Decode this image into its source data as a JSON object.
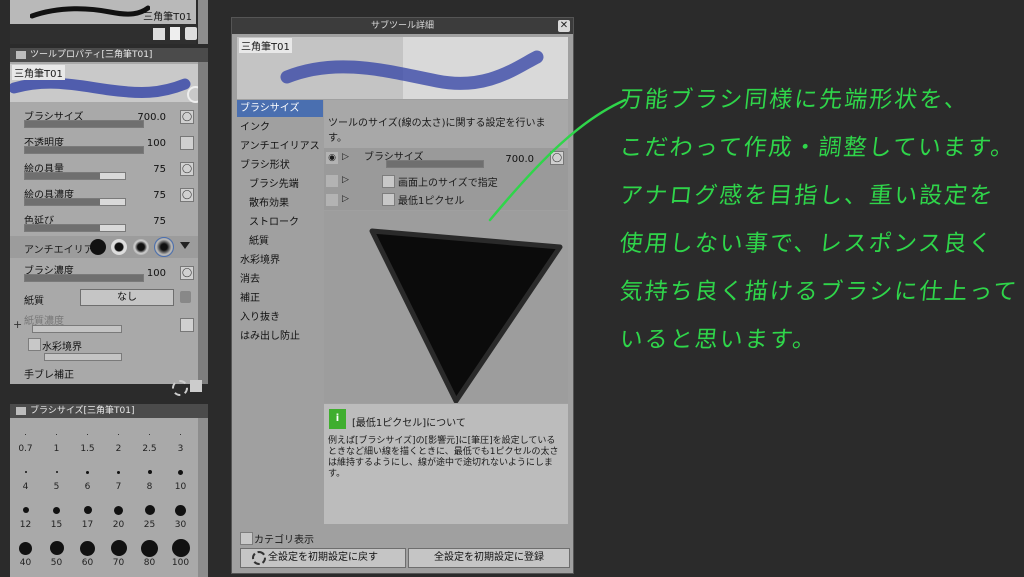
{
  "left_panel": {
    "brush_name_top": "三角筆T01",
    "tool_property_title": "ツールプロパティ[三角筆T01]",
    "brush_name_preview": "三角筆T01",
    "props": [
      {
        "label": "ブラシサイズ",
        "value": "700.0"
      },
      {
        "label": "不透明度",
        "value": "100"
      },
      {
        "label": "絵の具量",
        "value": "75"
      },
      {
        "label": "絵の具濃度",
        "value": "75"
      },
      {
        "label": "色延び",
        "value": "75"
      }
    ],
    "antialias_label": "アンチエイリアス",
    "brush_density_label": "ブラシ濃度",
    "brush_density_value": "100",
    "paper_label": "紙質",
    "paper_value": "なし",
    "paper_density_label": "紙質濃度",
    "watercolor_edge_label": "水彩境界",
    "stabilization_label": "手ブレ補正",
    "brush_size_panel_title": "ブラシサイズ[三角筆T01]",
    "sizes": [
      "0.7",
      "1",
      "1.5",
      "2",
      "2.5",
      "3",
      "4",
      "5",
      "6",
      "7",
      "8",
      "10",
      "12",
      "15",
      "17",
      "20",
      "25",
      "30",
      "40",
      "50",
      "60",
      "70",
      "80",
      "100"
    ]
  },
  "dialog": {
    "title": "サブツール詳細",
    "close": "✕",
    "brush_name": "三角筆T01",
    "categories": [
      {
        "label": "ブラシサイズ",
        "sub": false,
        "selected": true
      },
      {
        "label": "インク",
        "sub": false
      },
      {
        "label": "アンチエイリアス",
        "sub": false
      },
      {
        "label": "ブラシ形状",
        "sub": false
      },
      {
        "label": "ブラシ先端",
        "sub": true
      },
      {
        "label": "散布効果",
        "sub": true
      },
      {
        "label": "ストローク",
        "sub": true
      },
      {
        "label": "紙質",
        "sub": true
      },
      {
        "label": "水彩境界",
        "sub": false
      },
      {
        "label": "消去",
        "sub": false
      },
      {
        "label": "補正",
        "sub": false
      },
      {
        "label": "入り抜き",
        "sub": false
      },
      {
        "label": "はみ出し防止",
        "sub": false
      }
    ],
    "description": "ツールのサイズ(線の太さ)に関する設定を行います。",
    "setting_label": "ブラシサイズ",
    "setting_value": "700.0",
    "option1": "画面上のサイズで指定",
    "option2": "最低1ピクセル",
    "info_title": "[最低1ピクセル]について",
    "info_text": "例えば[ブラシサイズ]の[影響元]に[筆圧]を設定しているときなど細い線を描くときに、最低でも1ピクセルの太さは維持するようにし、線が途中で途切れないようにします。",
    "category_display": "カテゴリ表示",
    "reset_button": "全設定を初期設定に戻す",
    "register_button": "全設定を初期設定に登録"
  },
  "annotation": [
    "万能ブラシ同様に先端形状を、",
    "こだわって作成・調整しています。",
    "アナログ感を目指し、重い設定を",
    "使用しない事で、レスポンス良く",
    "気持ち良く描けるブラシに仕上って",
    "いると思います。"
  ],
  "colors": {
    "annotation": "#2fd54a",
    "selected": "#4a6fb0",
    "stroke": "#3b4aa8"
  }
}
